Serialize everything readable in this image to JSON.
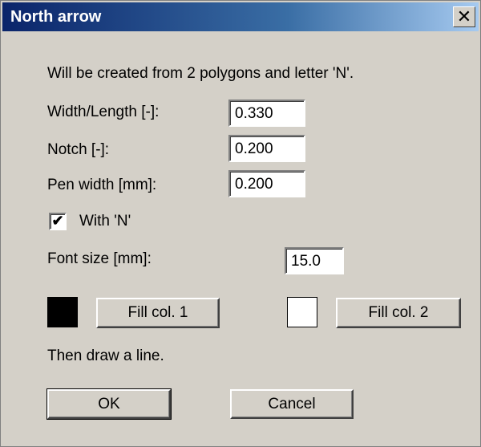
{
  "dialog": {
    "title": "North arrow",
    "close_glyph": "✕",
    "info_text": "Will be created from 2 polygons and letter 'N'.",
    "width_length": {
      "label": "Width/Length [-]:",
      "value": "0.330"
    },
    "notch": {
      "label": "Notch [-]:",
      "value": "0.200"
    },
    "pen_width": {
      "label": "Pen width [mm]:",
      "value": "0.200"
    },
    "with_n": {
      "label": "With 'N'",
      "checked": true,
      "check_glyph": "✔"
    },
    "font_size": {
      "label": "Font size [mm]:",
      "value": "15.0"
    },
    "fill1": {
      "label": "Fill col. 1",
      "color": "#000000"
    },
    "fill2": {
      "label": "Fill col. 2",
      "color": "#ffffff"
    },
    "then_text": "Then draw a line.",
    "ok_label": "OK",
    "cancel_label": "Cancel"
  }
}
